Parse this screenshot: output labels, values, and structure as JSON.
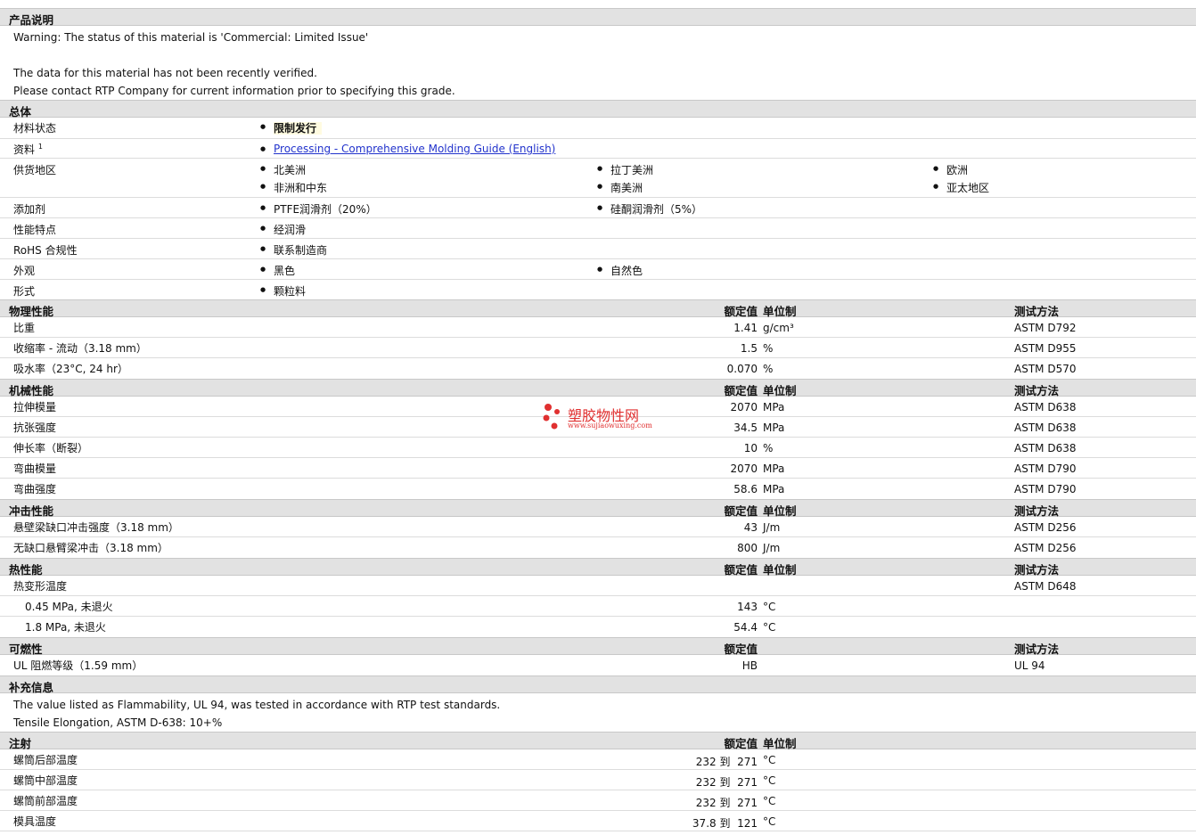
{
  "description": {
    "title": "产品说明",
    "lines": [
      "Warning: The status of this material is 'Commercial: Limited Issue'",
      "The data for this material has not been recently verified.",
      "Please contact RTP Company for current information prior to specifying this grade."
    ]
  },
  "general": {
    "title": "总体",
    "status_label": "材料状态",
    "status_value": "限制发行",
    "docs_label": "资料",
    "docs_sup": "1",
    "docs_link": "Processing - Comprehensive Molding Guide (English)",
    "regions_label": "供货地区",
    "regions": [
      "北美洲",
      "拉丁美洲",
      "欧洲",
      "非洲和中东",
      "南美洲",
      "亚太地区"
    ],
    "additive_label": "添加剂",
    "additives": [
      "PTFE润滑剂（20%）",
      "硅酮润滑剂（5%）"
    ],
    "features_label": "性能特点",
    "features": [
      "经润滑"
    ],
    "rohs_label": "RoHS 合规性",
    "rohs": [
      "联系制造商"
    ],
    "appearance_label": "外观",
    "appearance": [
      "黑色",
      "自然色"
    ],
    "form_label": "形式",
    "form": [
      "颗粒料"
    ]
  },
  "headers": {
    "nominal": "额定值",
    "unit": "单位制",
    "test": "测试方法"
  },
  "physical": {
    "title": "物理性能",
    "rows": [
      {
        "name": "比重",
        "value": "1.41",
        "unit": "g/cm³",
        "test": "ASTM D792"
      },
      {
        "name": "收缩率 - 流动（3.18 mm）",
        "value": "1.5",
        "unit": "%",
        "test": "ASTM D955"
      },
      {
        "name": "吸水率（23°C, 24 hr）",
        "value": "0.070",
        "unit": "%",
        "test": "ASTM D570"
      }
    ]
  },
  "mechanical": {
    "title": "机械性能",
    "rows": [
      {
        "name": "拉伸模量",
        "value": "2070",
        "unit": "MPa",
        "test": "ASTM D638"
      },
      {
        "name": "抗张强度",
        "value": "34.5",
        "unit": "MPa",
        "test": "ASTM D638"
      },
      {
        "name": "伸长率（断裂）",
        "value": "10",
        "unit": "%",
        "test": "ASTM D638"
      },
      {
        "name": "弯曲模量",
        "value": "2070",
        "unit": "MPa",
        "test": "ASTM D790"
      },
      {
        "name": "弯曲强度",
        "value": "58.6",
        "unit": "MPa",
        "test": "ASTM D790"
      }
    ]
  },
  "impact": {
    "title": "冲击性能",
    "rows": [
      {
        "name": "悬壁梁缺口冲击强度（3.18 mm）",
        "value": "43",
        "unit": "J/m",
        "test": "ASTM D256"
      },
      {
        "name": "无缺口悬臂梁冲击（3.18 mm）",
        "value": "800",
        "unit": "J/m",
        "test": "ASTM D256"
      }
    ]
  },
  "thermal": {
    "title": "热性能",
    "rows": [
      {
        "name": "热变形温度",
        "value": "",
        "unit": "",
        "test": "ASTM D648"
      },
      {
        "name": "0.45 MPa, 未退火",
        "value": "143",
        "unit": "°C",
        "test": ""
      },
      {
        "name": "1.8 MPa, 未退火",
        "value": "54.4",
        "unit": "°C",
        "test": ""
      }
    ]
  },
  "flammability": {
    "title": "可燃性",
    "rows": [
      {
        "name": "UL 阻燃等级（1.59 mm）",
        "value": "HB",
        "unit": "",
        "test": "UL 94"
      }
    ]
  },
  "supplement": {
    "title": "补充信息",
    "lines": [
      "The value listed as Flammability, UL 94, was tested in accordance with RTP test standards.",
      "Tensile Elongation, ASTM D-638: 10+%"
    ]
  },
  "injection": {
    "title": "注射",
    "rows": [
      {
        "name": "螺筒后部温度",
        "value": "232 到  271",
        "unit": "°C",
        "test": ""
      },
      {
        "name": "螺筒中部温度",
        "value": "232 到  271",
        "unit": "°C",
        "test": ""
      },
      {
        "name": "螺筒前部温度",
        "value": "232 到  271",
        "unit": "°C",
        "test": ""
      },
      {
        "name": "模具温度",
        "value": "37.8 到  121",
        "unit": "°C",
        "test": ""
      }
    ]
  },
  "watermark": {
    "text": "塑胶物性网",
    "url": "www.sujiaowuxing.com",
    "color": "#e03030"
  }
}
